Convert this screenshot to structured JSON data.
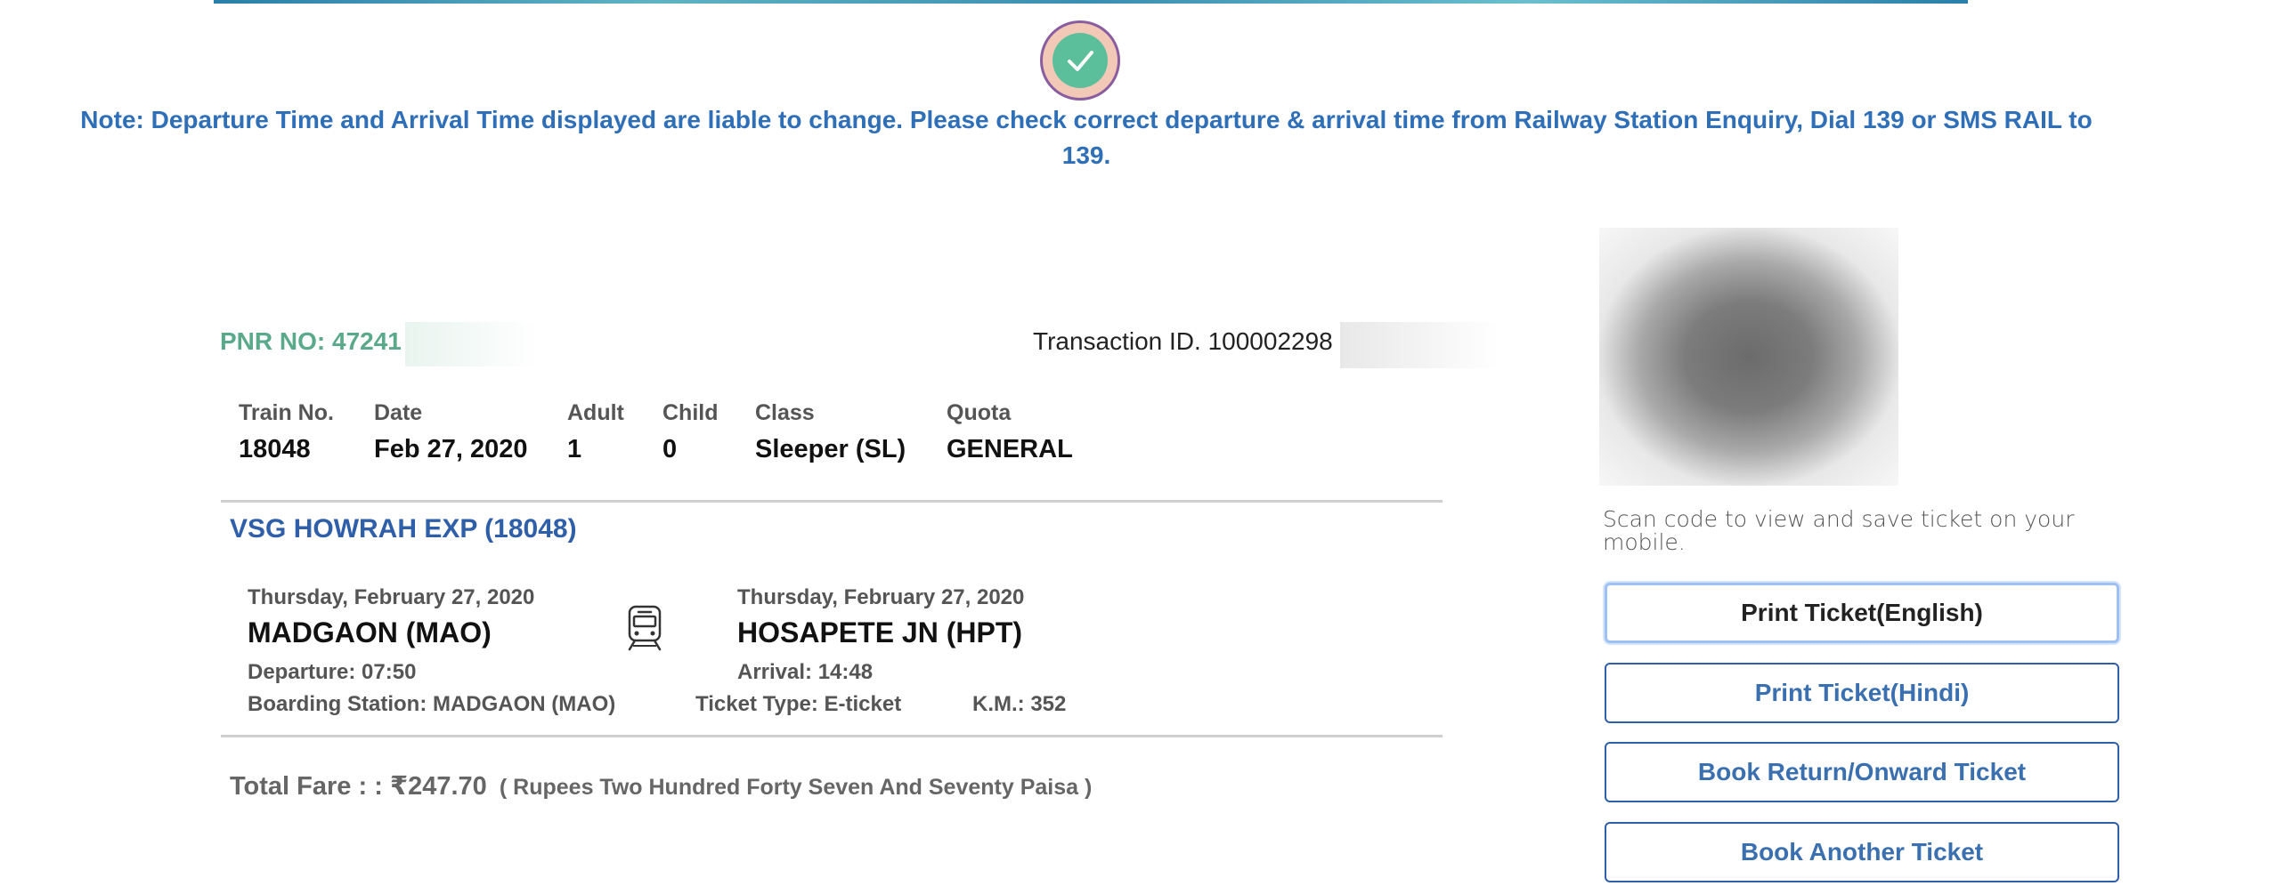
{
  "note": "Note: Departure Time and Arrival Time displayed are liable to change. Please check correct departure & arrival time from Railway Station Enquiry, Dial 139 or SMS RAIL to 139.",
  "pnr": "PNR NO: 47241",
  "transaction": "Transaction ID. 100002298",
  "info": {
    "train_no": {
      "label": "Train No.",
      "value": "18048"
    },
    "date": {
      "label": "Date",
      "value": "Feb 27, 2020"
    },
    "adult": {
      "label": "Adult",
      "value": "1"
    },
    "child": {
      "label": "Child",
      "value": "0"
    },
    "class": {
      "label": "Class",
      "value": "Sleeper (SL)"
    },
    "quota": {
      "label": "Quota",
      "value": "GENERAL"
    }
  },
  "train_name": "VSG HOWRAH EXP (18048)",
  "from": {
    "date": "Thursday, February 27, 2020",
    "station": "MADGAON (MAO)",
    "time": "Departure: 07:50"
  },
  "to": {
    "date": "Thursday, February 27, 2020",
    "station": "HOSAPETE JN (HPT)",
    "time": "Arrival: 14:48"
  },
  "boarding": "Boarding Station: MADGAON (MAO)",
  "ticket_type": "Ticket Type: E-ticket",
  "km": "K.M.: 352",
  "fare": {
    "label": "Total Fare : :",
    "amount": "₹247.70",
    "words": "( Rupees Two Hundred Forty Seven And Seventy Paisa )"
  },
  "scan_text": "Scan code to view and save ticket on your mobile.",
  "buttons": {
    "print_en": "Print Ticket(English)",
    "print_hi": "Print Ticket(Hindi)",
    "book_return": "Book Return/Onward Ticket",
    "book_another": "Book Another Ticket"
  },
  "colors": {
    "accent_blue": "#2f6fb8",
    "pnr_green": "#5aa98a",
    "check_green": "#5bbf9b"
  },
  "icons": [
    "check-icon",
    "train-icon"
  ]
}
